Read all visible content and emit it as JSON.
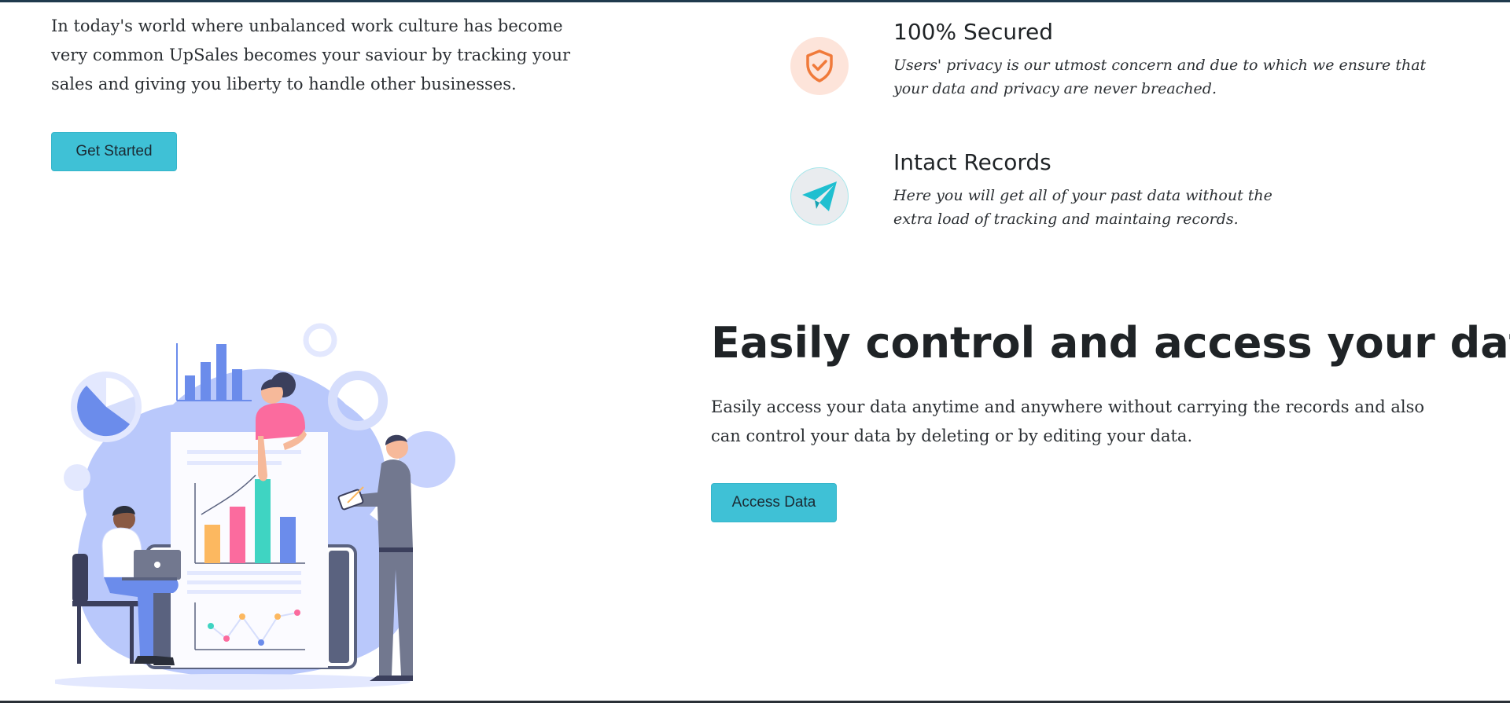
{
  "intro": {
    "text": "In today's world where unbalanced work culture has become very common UpSales becomes your saviour by tracking your sales and giving you liberty to handle other businesses.",
    "button_label": "Get Started"
  },
  "features": [
    {
      "icon": "shield-check-icon",
      "title": "100% Secured",
      "description": "Users' privacy is our utmost concern and due to which we ensure that your data and privacy are never breached."
    },
    {
      "icon": "paper-plane-icon",
      "title": "Intact Records",
      "description": "Here you will get all of your past data without the extra load of tracking and maintaing records."
    }
  ],
  "control": {
    "heading": "Easily control and access your data",
    "text": "Easily access your data anytime and anywhere without carrying the records and also can control your data by deleting or by editing your data.",
    "button_label": "Access Data"
  },
  "colors": {
    "accent": "#3fc1d6",
    "shield_orange": "#f07a3a",
    "plane_teal": "#1fbfd0",
    "illustration_blue": "#b9c8fb"
  }
}
